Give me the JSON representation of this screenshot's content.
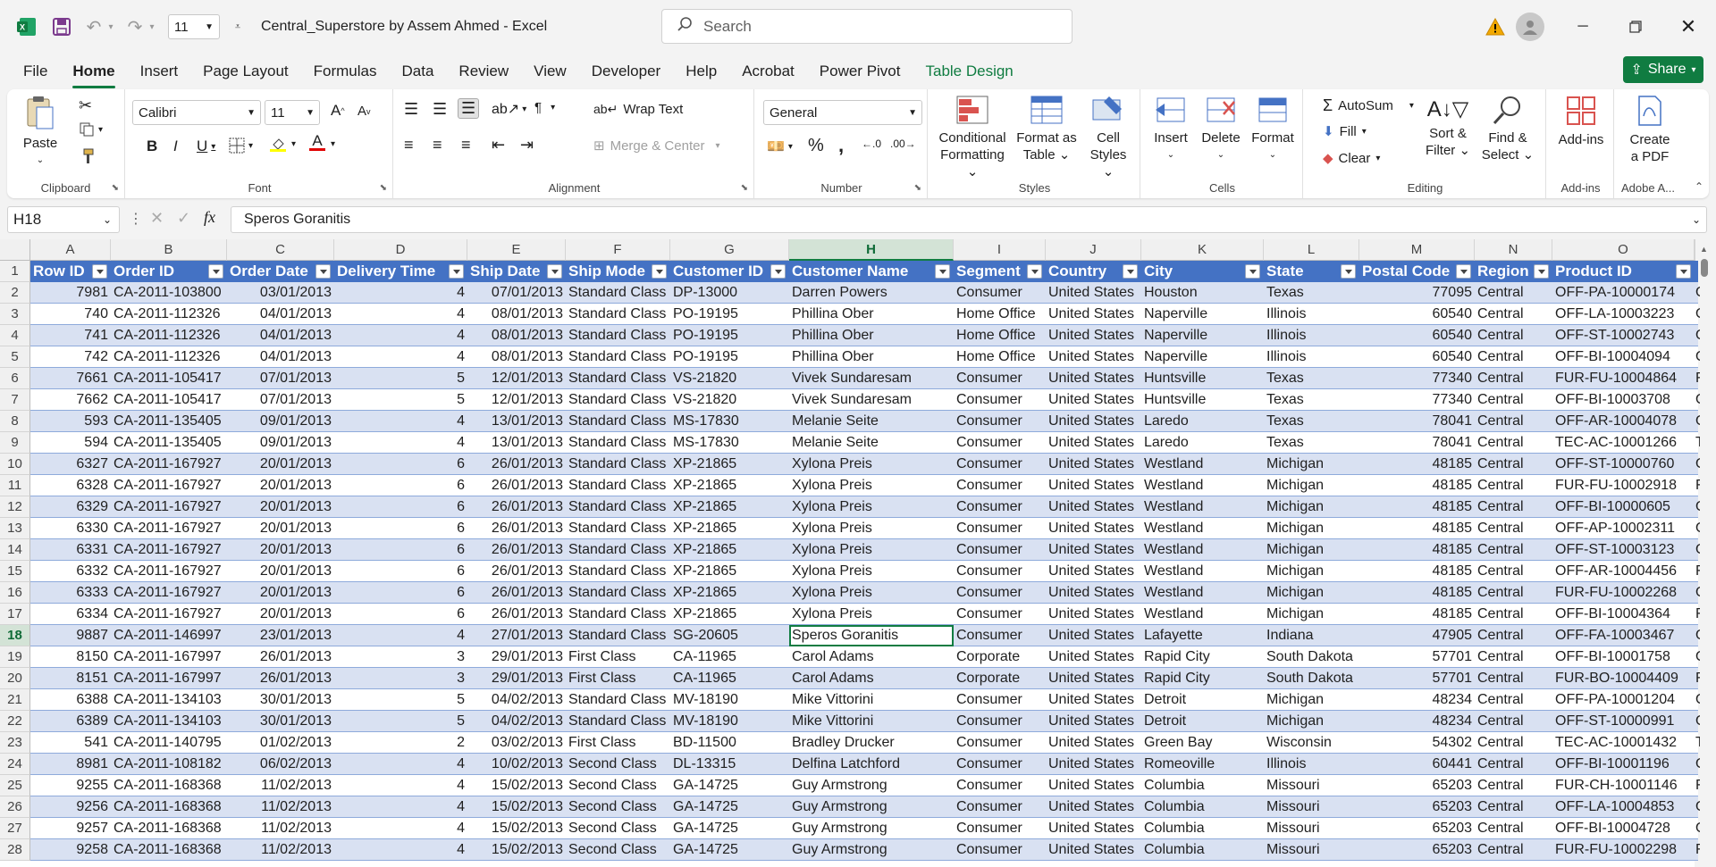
{
  "app": {
    "title": "Central_Superstore by Assem Ahmed  -  Excel",
    "font_size_quick": "11",
    "search_placeholder": "Search",
    "share_label": "Share"
  },
  "menu": {
    "tabs": [
      "File",
      "Home",
      "Insert",
      "Page Layout",
      "Formulas",
      "Data",
      "Review",
      "View",
      "Developer",
      "Help",
      "Acrobat",
      "Power Pivot",
      "Table Design"
    ],
    "active": "Home"
  },
  "ribbon": {
    "clipboard": {
      "paste": "Paste",
      "label": "Clipboard"
    },
    "font": {
      "name": "Calibri",
      "size": "11",
      "label": "Font"
    },
    "alignment": {
      "wrap": "Wrap Text",
      "merge": "Merge & Center",
      "label": "Alignment"
    },
    "number": {
      "format": "General",
      "label": "Number"
    },
    "styles": {
      "cond": "Conditional\nFormatting",
      "cond1": "Conditional",
      "cond2": "Formatting",
      "fmt1": "Format as",
      "fmt2": "Table",
      "cell1": "Cell",
      "cell2": "Styles",
      "label": "Styles"
    },
    "cells": {
      "insert": "Insert",
      "delete": "Delete",
      "format": "Format",
      "label": "Cells"
    },
    "editing": {
      "autosum": "AutoSum",
      "fill": "Fill",
      "clear": "Clear",
      "sort1": "Sort &",
      "sort2": "Filter",
      "find1": "Find &",
      "find2": "Select",
      "label": "Editing"
    },
    "addins": {
      "btn": "Add-ins",
      "label": "Add-ins"
    },
    "adobe": {
      "btn1": "Create",
      "btn2": "a PDF",
      "label": "Adobe A..."
    }
  },
  "formula_bar": {
    "name_box": "H18",
    "value": "Speros Goranitis"
  },
  "columns": [
    "A",
    "B",
    "C",
    "D",
    "E",
    "F",
    "G",
    "H",
    "I",
    "J",
    "K",
    "L",
    "M",
    "N",
    "O"
  ],
  "selected_column": "H",
  "selected_row": 18,
  "table_headers": [
    "Row ID",
    "Order ID",
    "Order Date",
    "Delivery Time",
    "Ship Date",
    "Ship Mode",
    "Customer ID",
    "Customer Name",
    "Segment",
    "Country",
    "City",
    "State",
    "Postal Code",
    "Region",
    "Product ID"
  ],
  "rows": [
    [
      "7981",
      "CA-2011-103800",
      "03/01/2013",
      "4",
      "07/01/2013",
      "Standard Class",
      "DP-13000",
      "Darren Powers",
      "Consumer",
      "United States",
      "Houston",
      "Texas",
      "77095",
      "Central",
      "OFF-PA-10000174"
    ],
    [
      "740",
      "CA-2011-112326",
      "04/01/2013",
      "4",
      "08/01/2013",
      "Standard Class",
      "PO-19195",
      "Phillina Ober",
      "Home Office",
      "United States",
      "Naperville",
      "Illinois",
      "60540",
      "Central",
      "OFF-LA-10003223"
    ],
    [
      "741",
      "CA-2011-112326",
      "04/01/2013",
      "4",
      "08/01/2013",
      "Standard Class",
      "PO-19195",
      "Phillina Ober",
      "Home Office",
      "United States",
      "Naperville",
      "Illinois",
      "60540",
      "Central",
      "OFF-ST-10002743"
    ],
    [
      "742",
      "CA-2011-112326",
      "04/01/2013",
      "4",
      "08/01/2013",
      "Standard Class",
      "PO-19195",
      "Phillina Ober",
      "Home Office",
      "United States",
      "Naperville",
      "Illinois",
      "60540",
      "Central",
      "OFF-BI-10004094"
    ],
    [
      "7661",
      "CA-2011-105417",
      "07/01/2013",
      "5",
      "12/01/2013",
      "Standard Class",
      "VS-21820",
      "Vivek Sundaresam",
      "Consumer",
      "United States",
      "Huntsville",
      "Texas",
      "77340",
      "Central",
      "FUR-FU-10004864"
    ],
    [
      "7662",
      "CA-2011-105417",
      "07/01/2013",
      "5",
      "12/01/2013",
      "Standard Class",
      "VS-21820",
      "Vivek Sundaresam",
      "Consumer",
      "United States",
      "Huntsville",
      "Texas",
      "77340",
      "Central",
      "OFF-BI-10003708"
    ],
    [
      "593",
      "CA-2011-135405",
      "09/01/2013",
      "4",
      "13/01/2013",
      "Standard Class",
      "MS-17830",
      "Melanie Seite",
      "Consumer",
      "United States",
      "Laredo",
      "Texas",
      "78041",
      "Central",
      "OFF-AR-10004078"
    ],
    [
      "594",
      "CA-2011-135405",
      "09/01/2013",
      "4",
      "13/01/2013",
      "Standard Class",
      "MS-17830",
      "Melanie Seite",
      "Consumer",
      "United States",
      "Laredo",
      "Texas",
      "78041",
      "Central",
      "TEC-AC-10001266"
    ],
    [
      "6327",
      "CA-2011-167927",
      "20/01/2013",
      "6",
      "26/01/2013",
      "Standard Class",
      "XP-21865",
      "Xylona Preis",
      "Consumer",
      "United States",
      "Westland",
      "Michigan",
      "48185",
      "Central",
      "OFF-ST-10000760"
    ],
    [
      "6328",
      "CA-2011-167927",
      "20/01/2013",
      "6",
      "26/01/2013",
      "Standard Class",
      "XP-21865",
      "Xylona Preis",
      "Consumer",
      "United States",
      "Westland",
      "Michigan",
      "48185",
      "Central",
      "FUR-FU-10002918"
    ],
    [
      "6329",
      "CA-2011-167927",
      "20/01/2013",
      "6",
      "26/01/2013",
      "Standard Class",
      "XP-21865",
      "Xylona Preis",
      "Consumer",
      "United States",
      "Westland",
      "Michigan",
      "48185",
      "Central",
      "OFF-BI-10000605"
    ],
    [
      "6330",
      "CA-2011-167927",
      "20/01/2013",
      "6",
      "26/01/2013",
      "Standard Class",
      "XP-21865",
      "Xylona Preis",
      "Consumer",
      "United States",
      "Westland",
      "Michigan",
      "48185",
      "Central",
      "OFF-AP-10002311"
    ],
    [
      "6331",
      "CA-2011-167927",
      "20/01/2013",
      "6",
      "26/01/2013",
      "Standard Class",
      "XP-21865",
      "Xylona Preis",
      "Consumer",
      "United States",
      "Westland",
      "Michigan",
      "48185",
      "Central",
      "OFF-ST-10003123"
    ],
    [
      "6332",
      "CA-2011-167927",
      "20/01/2013",
      "6",
      "26/01/2013",
      "Standard Class",
      "XP-21865",
      "Xylona Preis",
      "Consumer",
      "United States",
      "Westland",
      "Michigan",
      "48185",
      "Central",
      "OFF-AR-10004456"
    ],
    [
      "6333",
      "CA-2011-167927",
      "20/01/2013",
      "6",
      "26/01/2013",
      "Standard Class",
      "XP-21865",
      "Xylona Preis",
      "Consumer",
      "United States",
      "Westland",
      "Michigan",
      "48185",
      "Central",
      "FUR-FU-10002268"
    ],
    [
      "6334",
      "CA-2011-167927",
      "20/01/2013",
      "6",
      "26/01/2013",
      "Standard Class",
      "XP-21865",
      "Xylona Preis",
      "Consumer",
      "United States",
      "Westland",
      "Michigan",
      "48185",
      "Central",
      "OFF-BI-10004364"
    ],
    [
      "9887",
      "CA-2011-146997",
      "23/01/2013",
      "4",
      "27/01/2013",
      "Standard Class",
      "SG-20605",
      "Speros Goranitis",
      "Consumer",
      "United States",
      "Lafayette",
      "Indiana",
      "47905",
      "Central",
      "OFF-FA-10003467"
    ],
    [
      "8150",
      "CA-2011-167997",
      "26/01/2013",
      "3",
      "29/01/2013",
      "First Class",
      "CA-11965",
      "Carol Adams",
      "Corporate",
      "United States",
      "Rapid City",
      "South Dakota",
      "57701",
      "Central",
      "OFF-BI-10001758"
    ],
    [
      "8151",
      "CA-2011-167997",
      "26/01/2013",
      "3",
      "29/01/2013",
      "First Class",
      "CA-11965",
      "Carol Adams",
      "Corporate",
      "United States",
      "Rapid City",
      "South Dakota",
      "57701",
      "Central",
      "FUR-BO-10004409"
    ],
    [
      "6388",
      "CA-2011-134103",
      "30/01/2013",
      "5",
      "04/02/2013",
      "Standard Class",
      "MV-18190",
      "Mike Vittorini",
      "Consumer",
      "United States",
      "Detroit",
      "Michigan",
      "48234",
      "Central",
      "OFF-PA-10001204"
    ],
    [
      "6389",
      "CA-2011-134103",
      "30/01/2013",
      "5",
      "04/02/2013",
      "Standard Class",
      "MV-18190",
      "Mike Vittorini",
      "Consumer",
      "United States",
      "Detroit",
      "Michigan",
      "48234",
      "Central",
      "OFF-ST-10000991"
    ],
    [
      "541",
      "CA-2011-140795",
      "01/02/2013",
      "2",
      "03/02/2013",
      "First Class",
      "BD-11500",
      "Bradley Drucker",
      "Consumer",
      "United States",
      "Green Bay",
      "Wisconsin",
      "54302",
      "Central",
      "TEC-AC-10001432"
    ],
    [
      "8981",
      "CA-2011-108182",
      "06/02/2013",
      "4",
      "10/02/2013",
      "Second Class",
      "DL-13315",
      "Delfina Latchford",
      "Consumer",
      "United States",
      "Romeoville",
      "Illinois",
      "60441",
      "Central",
      "OFF-BI-10001196"
    ],
    [
      "9255",
      "CA-2011-168368",
      "11/02/2013",
      "4",
      "15/02/2013",
      "Second Class",
      "GA-14725",
      "Guy Armstrong",
      "Consumer",
      "United States",
      "Columbia",
      "Missouri",
      "65203",
      "Central",
      "FUR-CH-10001146"
    ],
    [
      "9256",
      "CA-2011-168368",
      "11/02/2013",
      "4",
      "15/02/2013",
      "Second Class",
      "GA-14725",
      "Guy Armstrong",
      "Consumer",
      "United States",
      "Columbia",
      "Missouri",
      "65203",
      "Central",
      "OFF-LA-10004853"
    ],
    [
      "9257",
      "CA-2011-168368",
      "11/02/2013",
      "4",
      "15/02/2013",
      "Second Class",
      "GA-14725",
      "Guy Armstrong",
      "Consumer",
      "United States",
      "Columbia",
      "Missouri",
      "65203",
      "Central",
      "OFF-BI-10004728"
    ],
    [
      "9258",
      "CA-2011-168368",
      "11/02/2013",
      "4",
      "15/02/2013",
      "Second Class",
      "GA-14725",
      "Guy Armstrong",
      "Consumer",
      "United States",
      "Columbia",
      "Missouri",
      "65203",
      "Central",
      "FUR-FU-10002298"
    ]
  ],
  "overflow_col_P": [
    "O",
    "O",
    "O",
    "O",
    "F",
    "O",
    "O",
    "T",
    "O",
    "F",
    "O",
    "O",
    "O",
    "F",
    "O",
    "F",
    "O",
    "O",
    "F",
    "O",
    "O",
    "T",
    "O",
    "F",
    "O",
    "O",
    "F"
  ],
  "colors": {
    "accent": "#107c41",
    "table_header": "#4472c4",
    "band_light": "#d9e1f2",
    "selected_fill": "#d3e3d6"
  }
}
